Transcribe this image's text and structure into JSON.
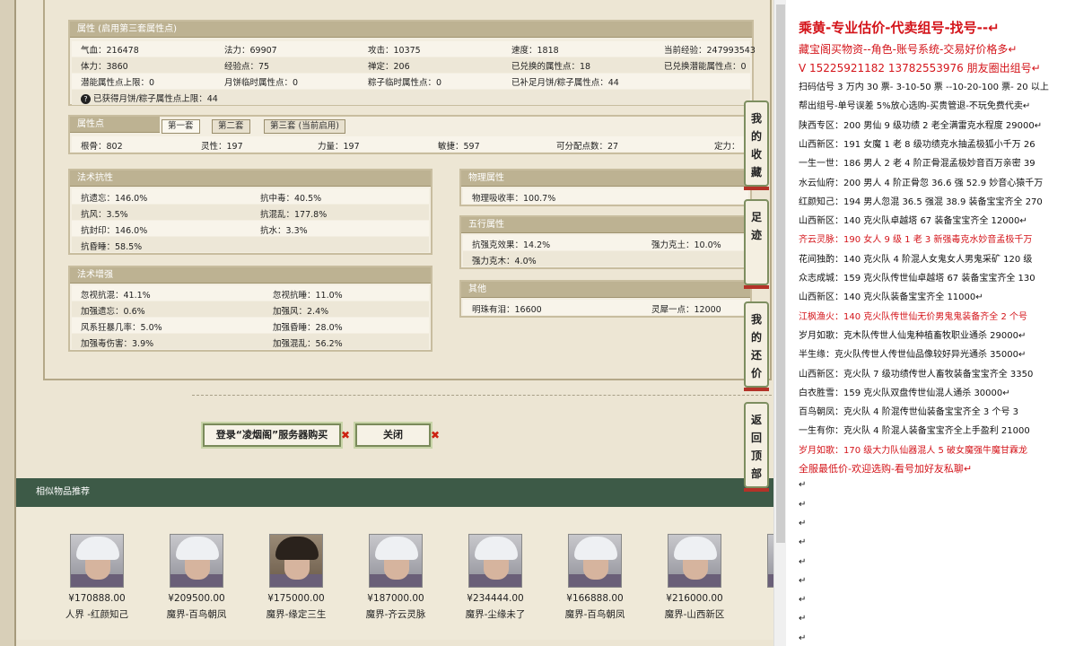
{
  "attributes": {
    "title": "属性 (启用第三套属性点)",
    "cells": [
      [
        "气血：216478",
        "法力：69907",
        "攻击：10375",
        "速度：1818",
        "当前经验：247993543"
      ],
      [
        "体力：3860",
        "经验点：75",
        "禅定：206",
        "已兑换的属性点：18",
        "已兑换潜能属性点：0"
      ],
      [
        "潜能属性点上限：0",
        "月饼临时属性点：0",
        "粽子临时属性点：0",
        "已补足月饼/粽子属性点：44",
        ""
      ]
    ],
    "note_icon": "?",
    "note": "已获得月饼/粽子属性点上限：44"
  },
  "points": {
    "title": "属性点",
    "tabs": [
      "第一套",
      "第二套",
      "第三套 (当前启用)"
    ],
    "cells": [
      "根骨：802",
      "灵性：197",
      "力量：197",
      "敏捷：597",
      "可分配点数：27",
      "定力："
    ]
  },
  "resist": {
    "title": "法术抗性",
    "cells": [
      [
        "抗遗忘：146.0%",
        "抗中毒：40.5%"
      ],
      [
        "抗风：3.5%",
        "抗混乱：177.8%"
      ],
      [
        "抗封印：146.0%",
        "抗水：3.3%"
      ],
      [
        "抗昏睡：58.5%",
        ""
      ]
    ]
  },
  "enhance": {
    "title": "法术增强",
    "cells": [
      [
        "忽视抗混：41.1%",
        "忽视抗睡：11.0%"
      ],
      [
        "加强遗忘：0.6%",
        "加强风：2.4%"
      ],
      [
        "风系狂暴几率：5.0%",
        "加强昏睡：28.0%"
      ],
      [
        "加强毒伤害：3.9%",
        "加强混乱：56.2%"
      ]
    ]
  },
  "physical": {
    "title": "物理属性",
    "cells": [
      "物理吸收率：100.7%"
    ]
  },
  "wuxing": {
    "title": "五行属性",
    "cells": [
      [
        "抗强克效果：14.2%",
        "强力克土：10.0%"
      ],
      [
        "强力克木：4.0%",
        ""
      ]
    ]
  },
  "other": {
    "title": "其他",
    "cells": [
      "明珠有泪：16600",
      "灵犀一点：12000"
    ]
  },
  "buttons": {
    "login_buy": "登录“凌烟阁”服务器购买",
    "close": "关闭",
    "x": "✖"
  },
  "similar": {
    "title": "相似物品推荐",
    "items": [
      {
        "price": "¥170888.00",
        "name": "人界 -红颜知己",
        "avatar": "silver"
      },
      {
        "price": "¥209500.00",
        "name": "魔界-百鸟朝凤",
        "avatar": "silver"
      },
      {
        "price": "¥175000.00",
        "name": "魔界-缘定三生",
        "avatar": "dark"
      },
      {
        "price": "¥187000.00",
        "name": "魔界-齐云灵脉",
        "avatar": "silver"
      },
      {
        "price": "¥234444.00",
        "name": "魔界-尘缘未了",
        "avatar": "silver"
      },
      {
        "price": "¥166888.00",
        "name": "魔界-百鸟朝凤",
        "avatar": "silver"
      },
      {
        "price": "¥216000.00",
        "name": "魔界-山西新区",
        "avatar": "silver"
      },
      {
        "price": "¥",
        "name": "魔",
        "avatar": "silver"
      }
    ]
  },
  "side_tabs": [
    {
      "label": "我的收藏"
    },
    {
      "label": "足迹"
    },
    {
      "label": "我的还价"
    },
    {
      "label": "返回顶部"
    }
  ],
  "doc": {
    "lines": [
      {
        "text": "乘黄-专业估价-代卖组号-找号--↵",
        "color": "red",
        "size": "15px",
        "bold": true
      },
      {
        "text": "藏宝阁买物资--角色-账号系统-交易好价格多↵",
        "color": "red",
        "size": "12px"
      },
      {
        "text": "V 15225921182    13782553976 朋友圈出组号↵",
        "color": "red",
        "size": "12px"
      },
      {
        "text": "扫码估号 3 万内 30 票- 3-10-50 票  --10-20-100 票- 20 以上",
        "color": "black"
      },
      {
        "text": "帮出组号-单号误差 5%放心选购-买贵管退-不玩免费代卖↵",
        "color": "black"
      },
      {
        "text": "陕西专区：200 男仙 9 级功绩 2 老全满雷克水程度 29000↵",
        "color": "black"
      },
      {
        "text": "山西新区：191 女魔 1 老 8 级功绩克水抽孟极狐小千万 26",
        "color": "black"
      },
      {
        "text": "一生一世：186 男人 2 老 4 阶正骨混孟极妙音百万亲密 39",
        "color": "black"
      },
      {
        "text": "水云仙府：200 男人 4 阶正骨忽 36.6 强 52.9 妙音心猿千万",
        "color": "black"
      },
      {
        "text": "红颜知己：194 男人忽混 36.5 强混 38.9 装备宝宝齐全 270",
        "color": "black"
      },
      {
        "text": "山西新区：140 克火队卓越塔 67 装备宝宝齐全 12000↵",
        "color": "black"
      },
      {
        "text": "齐云灵脉：190 女人 9 级 1 老 3 新强毒克水妙音孟极千万",
        "color": "red"
      },
      {
        "text": "花间独酌：140 克火队 4 阶混人女鬼女人男鬼采矿 120 级",
        "color": "black"
      },
      {
        "text": "众志成城：159 克火队传世仙卓越塔 67 装备宝宝齐全 130",
        "color": "black"
      },
      {
        "text": "山西新区：140 克火队装备宝宝齐全 11000↵",
        "color": "black"
      },
      {
        "text": "江枫渔火：140 克火队传世仙无价男鬼鬼装备齐全 2 个号",
        "color": "red"
      },
      {
        "text": "岁月如歌：克木队传世人仙鬼种植畜牧职业通杀 29000↵",
        "color": "black"
      },
      {
        "text": "半生缘：克火队传世人传世仙品像较好异光通杀 35000↵",
        "color": "black"
      },
      {
        "text": "山西新区：克火队 7 级功绩传世人畜牧装备宝宝齐全 3350",
        "color": "black"
      },
      {
        "text": "白衣胜雪：159 克火队双盘传世仙混人通杀 30000↵",
        "color": "black"
      },
      {
        "text": "百鸟朝凤：克火队 4 阶混传世仙装备宝宝齐全 3 个号 3",
        "color": "black"
      },
      {
        "text": "一生有你：克火队 4 阶混人装备宝宝齐全上手盈利 21000",
        "color": "black"
      },
      {
        "text": "岁月如歌：170 级大力队仙器混人 5 破女魔强牛魔甘霖龙",
        "color": "red"
      },
      {
        "text": "全服最低价-欢迎选购-看号加好友私聊↵",
        "color": "red",
        "size": "11px"
      },
      {
        "text": "↵",
        "color": "black"
      },
      {
        "text": "↵",
        "color": "black"
      },
      {
        "text": "↵",
        "color": "black"
      },
      {
        "text": "↵",
        "color": "black"
      },
      {
        "text": "↵",
        "color": "black"
      },
      {
        "text": "↵",
        "color": "black"
      },
      {
        "text": "↵",
        "color": "black"
      },
      {
        "text": "↵",
        "color": "black"
      },
      {
        "text": "↵",
        "color": "black"
      }
    ]
  }
}
